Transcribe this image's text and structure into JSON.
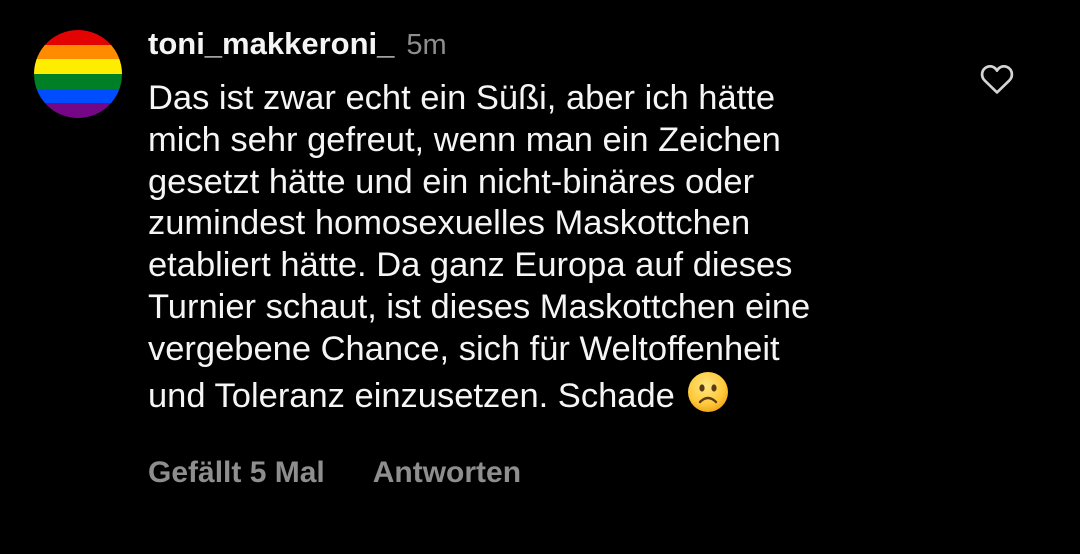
{
  "comment": {
    "avatar_icon": "pride-flag-avatar",
    "avatar_colors": [
      "#e40303",
      "#ff8c00",
      "#ffed00",
      "#008026",
      "#004dff",
      "#750787"
    ],
    "username": "toni_makkeroni_",
    "timestamp": "5m",
    "text_lines": [
      "Das ist zwar echt ein Süßi, aber ich hätte",
      "mich sehr gefreut, wenn man ein Zeichen",
      "gesetzt hätte und ein nicht-binäres oder",
      "zumindest homosexuelles Maskottchen",
      "etabliert hätte. Da ganz Europa auf dieses",
      "Turnier schaut, ist dieses Maskottchen eine",
      "vergebene Chance, sich für Weltoffenheit",
      "und Toleranz einzusetzen. Schade"
    ],
    "emoji": "frowning-face-emoji",
    "like_icon": "heart-outline-icon",
    "likes_label": "Gefällt 5 Mal",
    "reply_label": "Antworten"
  },
  "colors": {
    "background": "#000000",
    "primary_text": "#f5f5f5",
    "secondary_text": "#8e8e8e"
  }
}
